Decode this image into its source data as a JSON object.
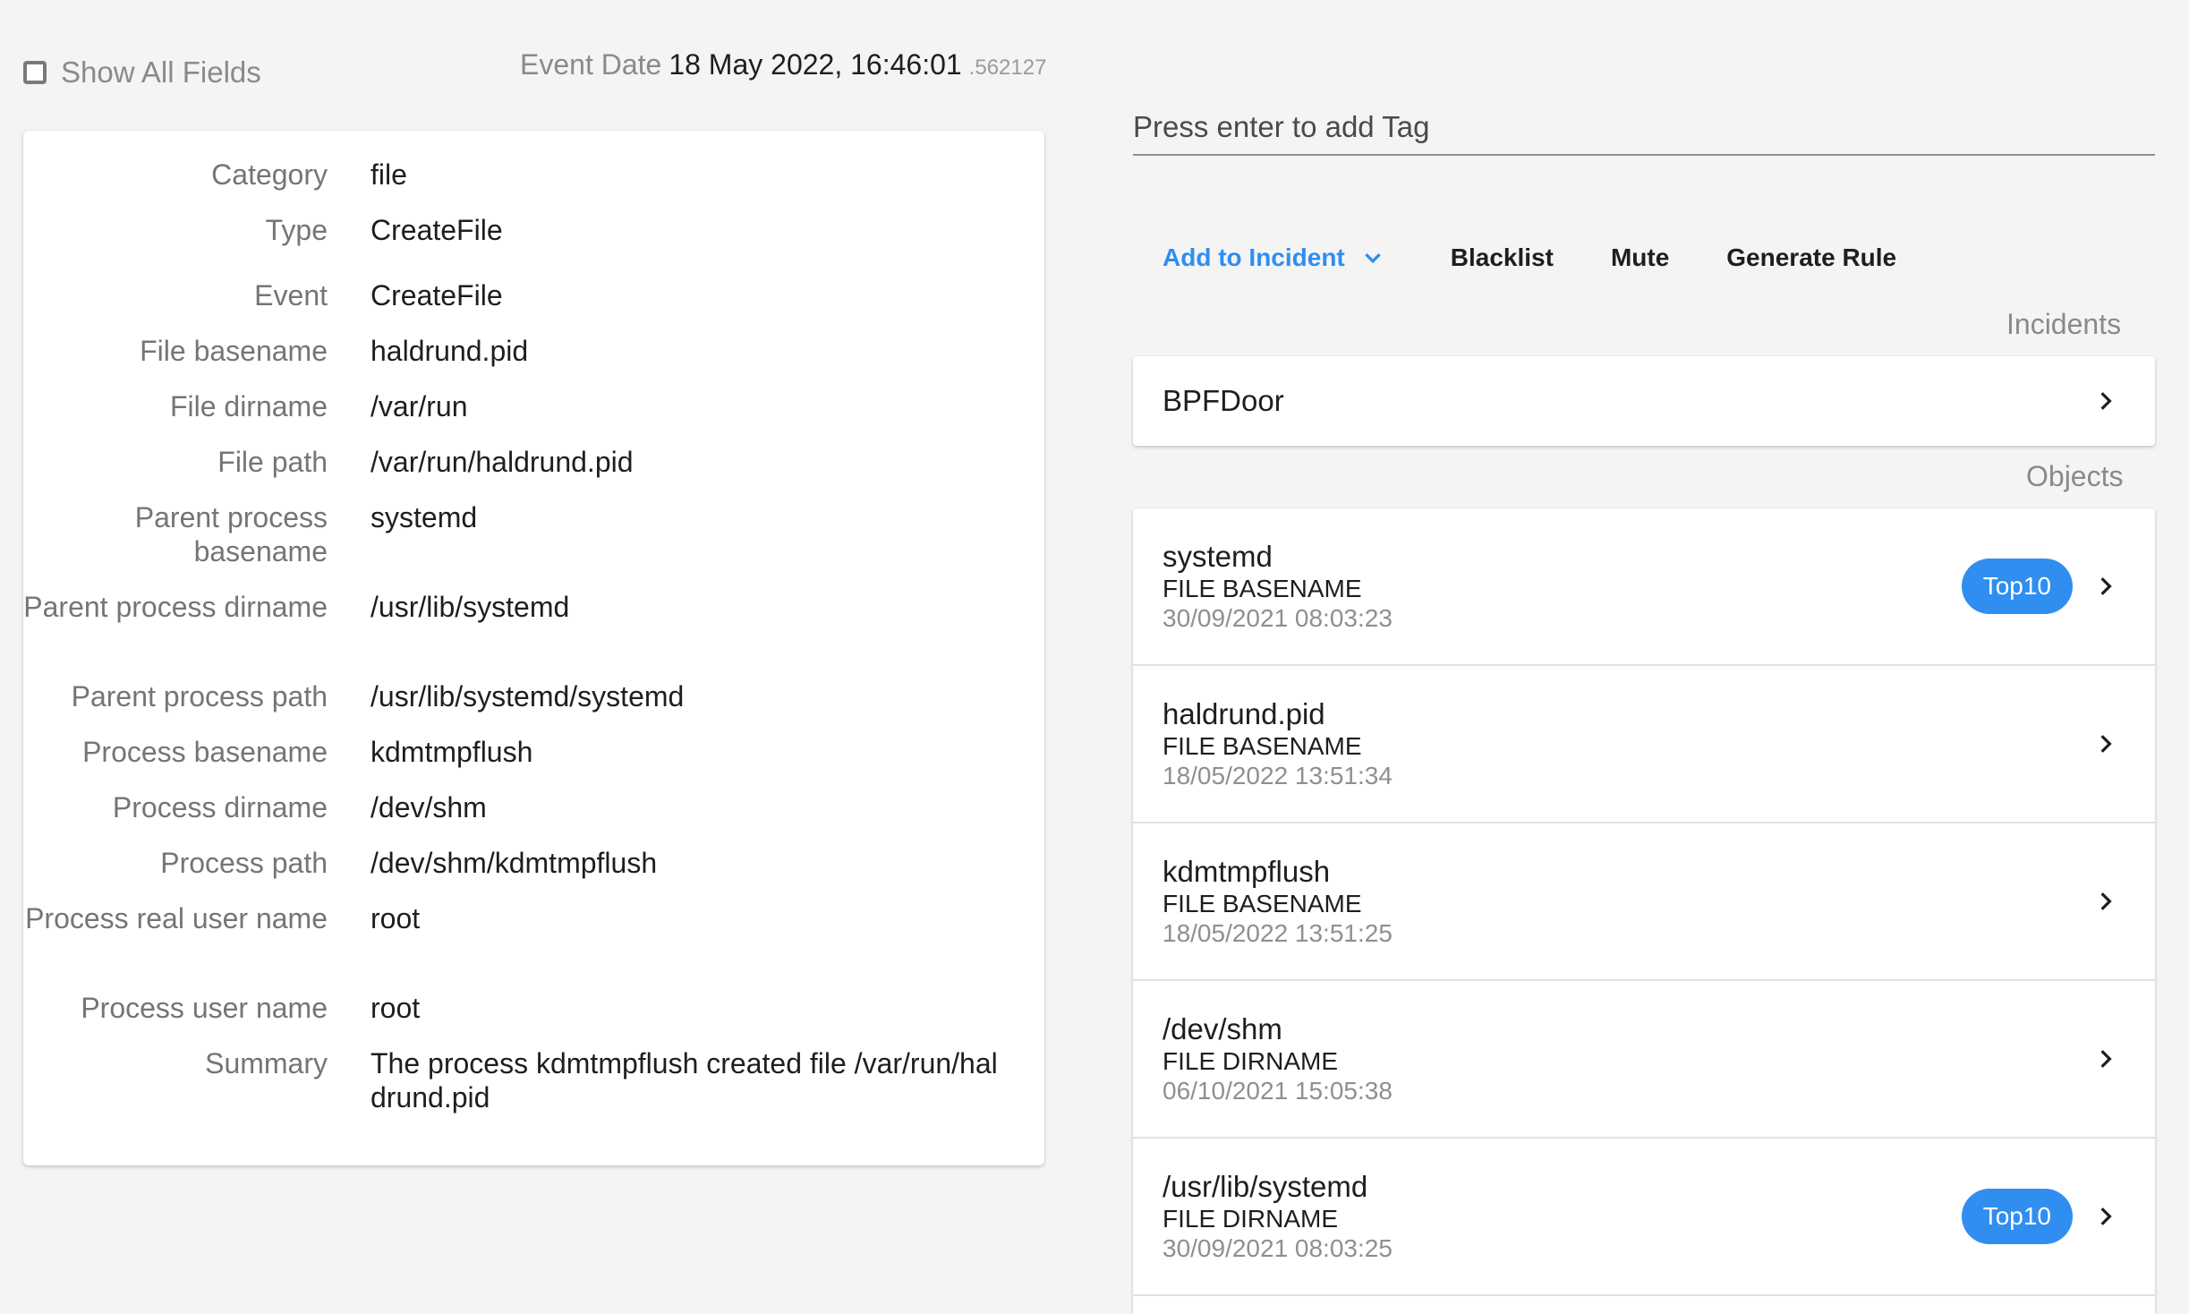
{
  "toolbar": {
    "show_all_label": "Show All Fields",
    "event_date_label": "Event Date",
    "event_date_value": "18 May 2022, 16:46:01",
    "event_date_ms": ".562127"
  },
  "fields": [
    {
      "label": "Category",
      "value": "file"
    },
    {
      "label": "Type",
      "value": "CreateFile"
    },
    {
      "label": "Event",
      "value": "CreateFile"
    },
    {
      "label": "File basename",
      "value": "haldrund.pid"
    },
    {
      "label": "File dirname",
      "value": "/var/run"
    },
    {
      "label": "File path",
      "value": "/var/run/haldrund.pid"
    },
    {
      "label": "Parent process basename",
      "value": "systemd"
    },
    {
      "label": "Parent process dirname",
      "value": "/usr/lib/systemd"
    },
    {
      "label": "Parent process path",
      "value": "/usr/lib/systemd/systemd"
    },
    {
      "label": "Process basename",
      "value": "kdmtmpflush"
    },
    {
      "label": "Process dirname",
      "value": "/dev/shm"
    },
    {
      "label": "Process path",
      "value": "/dev/shm/kdmtmpflush"
    },
    {
      "label": "Process real user name",
      "value": "root"
    },
    {
      "label": "Process user name",
      "value": "root"
    },
    {
      "label": "Summary",
      "value": "The process kdmtmpflush created file /var/run/haldrund.pid"
    }
  ],
  "tag": {
    "placeholder": "Press enter to add Tag"
  },
  "actions": {
    "add_to_incident": "Add to Incident",
    "blacklist": "Blacklist",
    "mute": "Mute",
    "generate_rule": "Generate Rule"
  },
  "incidents": {
    "title": "Incidents",
    "items": [
      {
        "name": "BPFDoor"
      }
    ]
  },
  "objects": {
    "title": "Objects",
    "items": [
      {
        "name": "systemd",
        "type": "FILE BASENAME",
        "date": "30/09/2021 08:03:23",
        "badge": "Top10"
      },
      {
        "name": "haldrund.pid",
        "type": "FILE BASENAME",
        "date": "18/05/2022 13:51:34",
        "badge": ""
      },
      {
        "name": "kdmtmpflush",
        "type": "FILE BASENAME",
        "date": "18/05/2022 13:51:25",
        "badge": ""
      },
      {
        "name": "/dev/shm",
        "type": "FILE DIRNAME",
        "date": "06/10/2021 15:05:38",
        "badge": ""
      },
      {
        "name": "/usr/lib/systemd",
        "type": "FILE DIRNAME",
        "date": "30/09/2021 08:03:25",
        "badge": "Top10"
      }
    ]
  },
  "colors": {
    "accent": "#2f8ef0",
    "background": "#f4f4f4",
    "card": "#ffffff"
  },
  "icons": {
    "checkbox": "checkbox-unchecked-icon",
    "dropdown": "chevron-down-icon",
    "row_arrow": "chevron-right-icon"
  }
}
